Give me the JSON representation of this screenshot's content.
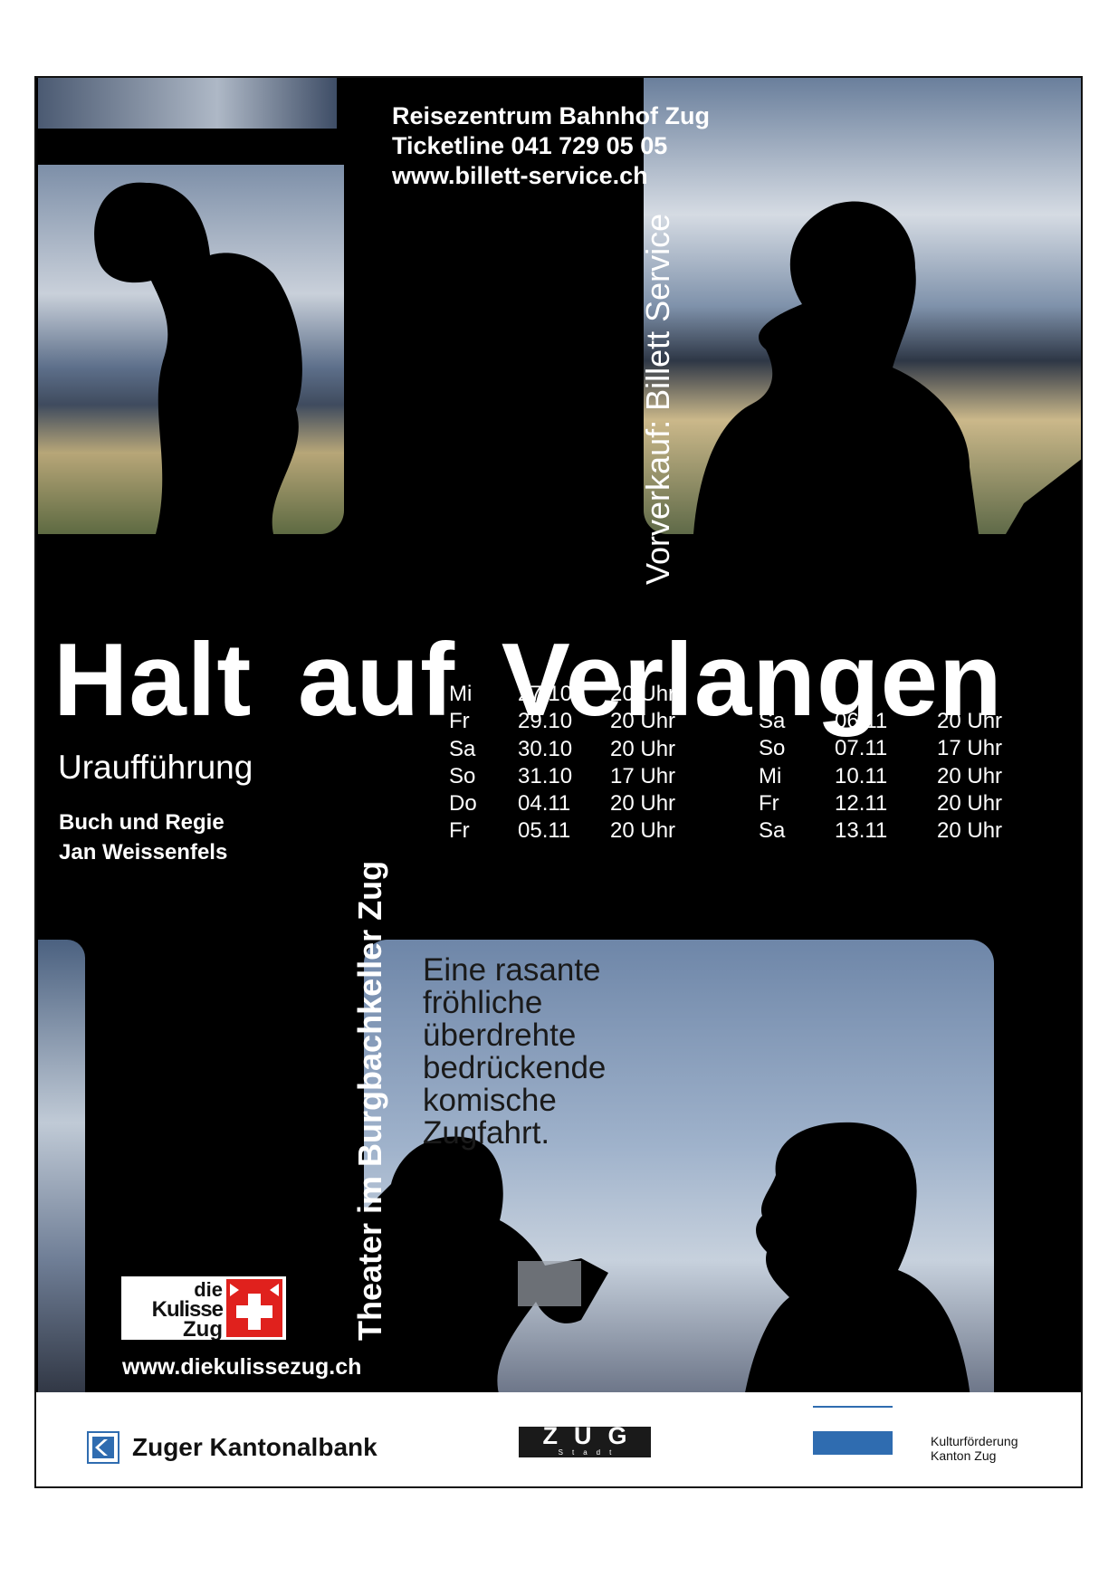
{
  "contact": {
    "line1": "Reisezentrum Bahnhof Zug",
    "line2": "Ticketline 041 729 05 05",
    "line3": "www.billett-service.ch"
  },
  "presale": "Vorverkauf: Billett Service",
  "title": "Halt auf Verlangen",
  "subtitle": "Uraufführung",
  "credits": {
    "role": "Buch und Regie",
    "name": "Jan Weissenfels"
  },
  "venue": "Theater im Burgbachkeller Zug",
  "dates_left": [
    {
      "day": "Mi",
      "date": "27.10",
      "time": "20 Uhr"
    },
    {
      "day": "Fr",
      "date": "29.10",
      "time": "20 Uhr"
    },
    {
      "day": "Sa",
      "date": "30.10",
      "time": "20 Uhr"
    },
    {
      "day": "So",
      "date": "31.10",
      "time": "17 Uhr"
    },
    {
      "day": "Do",
      "date": "04.11",
      "time": "20 Uhr"
    },
    {
      "day": "Fr",
      "date": "05.11",
      "time": "20 Uhr"
    }
  ],
  "dates_right": [
    {
      "day": "Sa",
      "date": "06.11",
      "time": "20 Uhr"
    },
    {
      "day": "So",
      "date": "07.11",
      "time": "17 Uhr"
    },
    {
      "day": "Mi",
      "date": "10.11",
      "time": "20 Uhr"
    },
    {
      "day": "Fr",
      "date": "12.11",
      "time": "20 Uhr"
    },
    {
      "day": "Sa",
      "date": "13.11",
      "time": "20 Uhr"
    }
  ],
  "tagline": [
    "Eine rasante",
    "fröhliche",
    "überdrehte",
    "bedrückende",
    "komische",
    "Zugfahrt."
  ],
  "logo": {
    "line1": "die",
    "line2": "Kulisse",
    "line3": "Zug"
  },
  "website": "www.diekulissezug.ch",
  "sponsors": {
    "bank": "Zuger Kantonalbank",
    "city_main": "ZUG",
    "city_sub": "Stadt",
    "culture_line1": "Kulturförderung",
    "culture_line2": "Kanton Zug"
  },
  "colors": {
    "background": "#000000",
    "text": "#ffffff",
    "sky": "#8fa4be",
    "field": "#b9a779",
    "canton_blue": "#2f6cb0",
    "logo_red": "#e0211d"
  }
}
